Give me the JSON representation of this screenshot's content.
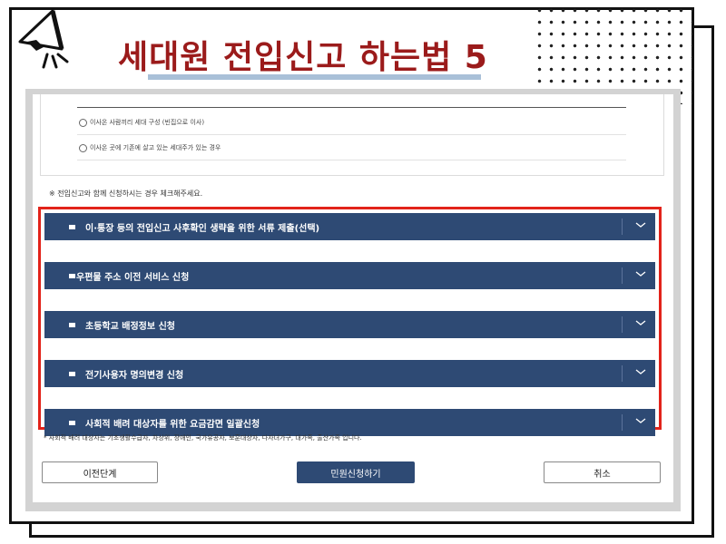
{
  "title": "세대원 전입신고 하는법 5",
  "options": [
    "이사온 사람끼리 세대 구성 (빈집으로 이사)",
    "이사온 곳에 기존에 살고 있는 세대주가 있는 경우"
  ],
  "note": "※ 전입신고와 함께 신청하시는 경우 체크해주세요.",
  "sections": [
    "이·통장 등의 전입신고 사후확인 생략을 위한 서류 제출(선택)",
    "우편물 주소 이전 서비스 신청",
    "초등학교 배정정보 신청",
    "전기사용자 명의변경 신청",
    "사회적 배려 대상자를 위한 요금감면 일괄신청"
  ],
  "footnote": "* 사회적 배려 대상자는 기초생활수급자, 차상위, 장애인, 국가유공자, 보훈대상자, 다자녀가구, 대가족, 출산가족 입니다.",
  "buttons": {
    "prev": "이전단계",
    "apply": "민원신청하기",
    "cancel": "취소"
  },
  "colors": {
    "title": "#9b1b1b",
    "section_bar": "#2e4a74",
    "highlight": "#e2231a",
    "underline": "#a9c0d8"
  },
  "icons": [
    "megaphone-icon",
    "chevron-down-icon"
  ]
}
